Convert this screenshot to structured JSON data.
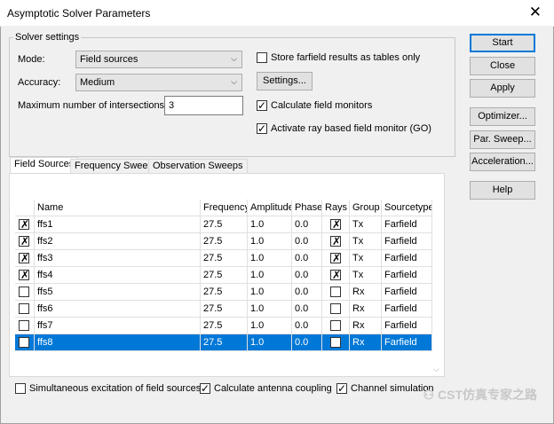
{
  "window": {
    "title": "Asymptotic Solver Parameters"
  },
  "solver_settings": {
    "group_title": "Solver settings",
    "mode_label": "Mode:",
    "mode_value": "Field sources",
    "accuracy_label": "Accuracy:",
    "accuracy_value": "Medium",
    "max_intersections_label": "Maximum number of intersections:",
    "max_intersections_value": "3",
    "store_farfield_label": "Store farfield results as tables only",
    "settings_button": "Settings...",
    "calc_field_monitors_label": "Calculate field monitors",
    "activate_ray_label": "Activate ray based field monitor (GO)"
  },
  "side_buttons": {
    "start": "Start",
    "close": "Close",
    "apply": "Apply",
    "optimizer": "Optimizer...",
    "par_sweep": "Par. Sweep...",
    "acceleration": "Acceleration...",
    "help": "Help"
  },
  "tabs": [
    "Field Sources",
    "Frequency Sweeps",
    "Observation Sweeps"
  ],
  "table": {
    "headers": [
      "Name",
      "Frequency",
      "Amplitude",
      "Phase",
      "Rays",
      "Group",
      "Sourcetype"
    ],
    "rows": [
      {
        "checked": true,
        "name": "ffs1",
        "frequency": "27.5",
        "amplitude": "1.0",
        "phase": "0.0",
        "rays": true,
        "group": "Tx",
        "sourcetype": "Farfield"
      },
      {
        "checked": true,
        "name": "ffs2",
        "frequency": "27.5",
        "amplitude": "1.0",
        "phase": "0.0",
        "rays": true,
        "group": "Tx",
        "sourcetype": "Farfield"
      },
      {
        "checked": true,
        "name": "ffs3",
        "frequency": "27.5",
        "amplitude": "1.0",
        "phase": "0.0",
        "rays": true,
        "group": "Tx",
        "sourcetype": "Farfield"
      },
      {
        "checked": true,
        "name": "ffs4",
        "frequency": "27.5",
        "amplitude": "1.0",
        "phase": "0.0",
        "rays": true,
        "group": "Tx",
        "sourcetype": "Farfield"
      },
      {
        "checked": false,
        "name": "ffs5",
        "frequency": "27.5",
        "amplitude": "1.0",
        "phase": "0.0",
        "rays": false,
        "group": "Rx",
        "sourcetype": "Farfield"
      },
      {
        "checked": false,
        "name": "ffs6",
        "frequency": "27.5",
        "amplitude": "1.0",
        "phase": "0.0",
        "rays": false,
        "group": "Rx",
        "sourcetype": "Farfield"
      },
      {
        "checked": false,
        "name": "ffs7",
        "frequency": "27.5",
        "amplitude": "1.0",
        "phase": "0.0",
        "rays": false,
        "group": "Rx",
        "sourcetype": "Farfield"
      },
      {
        "checked": false,
        "name": "ffs8",
        "frequency": "27.5",
        "amplitude": "1.0",
        "phase": "0.0",
        "rays": false,
        "group": "Rx",
        "sourcetype": "Farfield",
        "selected": true
      }
    ]
  },
  "bottom_options": {
    "simultaneous_label": "Simultaneous excitation of field sources",
    "antenna_coupling_label": "Calculate antenna coupling",
    "channel_sim_label": "Channel simulation"
  },
  "watermark": "CST仿真专家之路",
  "colors": {
    "selection": "#0078d7",
    "dialog_bg": "#f0f0f0"
  }
}
